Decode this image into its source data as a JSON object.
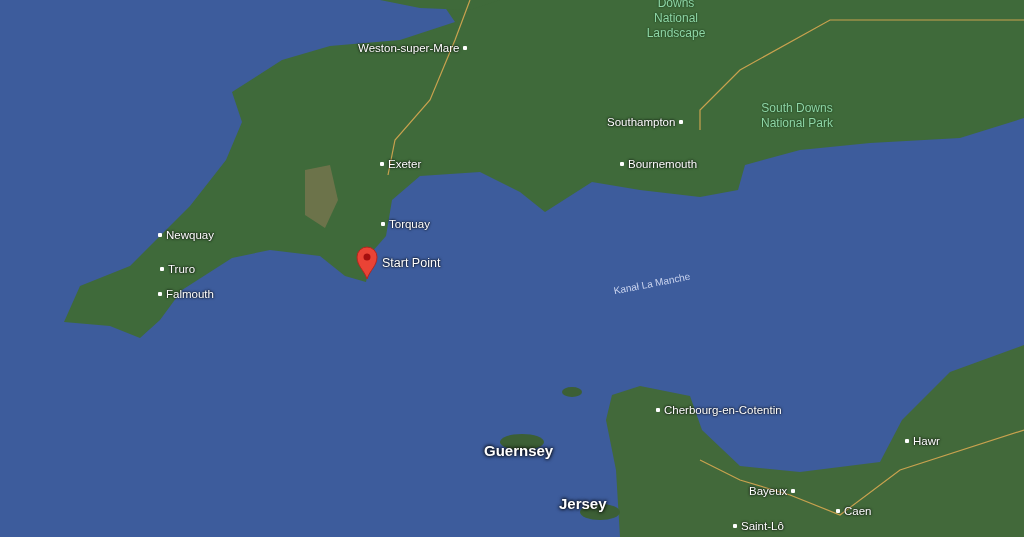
{
  "map": {
    "labels": [
      {
        "kind": "city",
        "text": "Weston-super-Mare"
      },
      {
        "kind": "park",
        "text": "Downs National Landscape"
      },
      {
        "kind": "city",
        "text": "Southampton"
      },
      {
        "kind": "park",
        "text": "South Downs National Park"
      },
      {
        "kind": "city",
        "text": "Exeter"
      },
      {
        "kind": "city",
        "text": "Bournemouth"
      },
      {
        "kind": "city",
        "text": "Torquay"
      },
      {
        "kind": "city",
        "text": "Newquay"
      },
      {
        "kind": "city",
        "text": "Truro"
      },
      {
        "kind": "city",
        "text": "Falmouth"
      },
      {
        "kind": "pin",
        "text": "Start Point"
      },
      {
        "kind": "sea",
        "text": "Kanał La Manche"
      },
      {
        "kind": "city",
        "text": "Cherbourg-en-Cotentin"
      },
      {
        "kind": "island",
        "text": "Guernsey"
      },
      {
        "kind": "island",
        "text": "Jersey"
      },
      {
        "kind": "city",
        "text": "Hawr"
      },
      {
        "kind": "city",
        "text": "Bayeux"
      },
      {
        "kind": "city",
        "text": "Caen"
      },
      {
        "kind": "city",
        "text": "Saint-Lô"
      }
    ]
  }
}
